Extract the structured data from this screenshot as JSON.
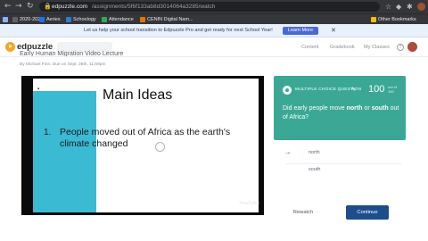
{
  "browser": {
    "url_host": "edpuzzle.com",
    "url_path": "/assignments/5f6f133ab8d3014064a3285/watch",
    "bookmarks": [
      {
        "label": "2020-2021",
        "color": "#5f6368"
      },
      {
        "label": "Aeries",
        "color": "#1a73e8"
      },
      {
        "label": "Schoology",
        "color": "#2d7dd2"
      },
      {
        "label": "Attendance",
        "color": "#34a853"
      },
      {
        "label": "CENIN Digital Nam...",
        "color": "#e37400"
      },
      {
        "label": "Other Bookmarks",
        "color": "#fbbc04"
      }
    ]
  },
  "banner": {
    "text": "Let us help your school transition to Edpuzzle Pro and get ready for next School Year!",
    "button": "Learn More"
  },
  "header": {
    "logo": "edpuzzle",
    "nav": [
      "Content",
      "Gradebook",
      "My Classes"
    ]
  },
  "video": {
    "title": "Early Human Migration Video Lecture",
    "meta": "By Michael Finn. Due on Sept. 28th, 11:59pm"
  },
  "slide": {
    "heading": "Main Ideas",
    "number": "1.",
    "bullet": "People moved out of Africa as the earth's climate changed",
    "watermark": "YouTube"
  },
  "question": {
    "type": "MULTIPLE CHOICE QUESTION",
    "points": "100",
    "points_label": "out of 100",
    "text_prefix": "Did early people move ",
    "text_bold1": "north",
    "text_mid": " or ",
    "text_bold2": "south",
    "text_suffix": " out of Africa?",
    "answers": [
      "north",
      "south"
    ]
  },
  "actions": {
    "rewatch": "Rewatch",
    "continue": "Continue"
  },
  "colors": {
    "accent_teal": "#3aa895",
    "continue_blue": "#1e4d8c",
    "slide_teal": "#3bbad3"
  }
}
